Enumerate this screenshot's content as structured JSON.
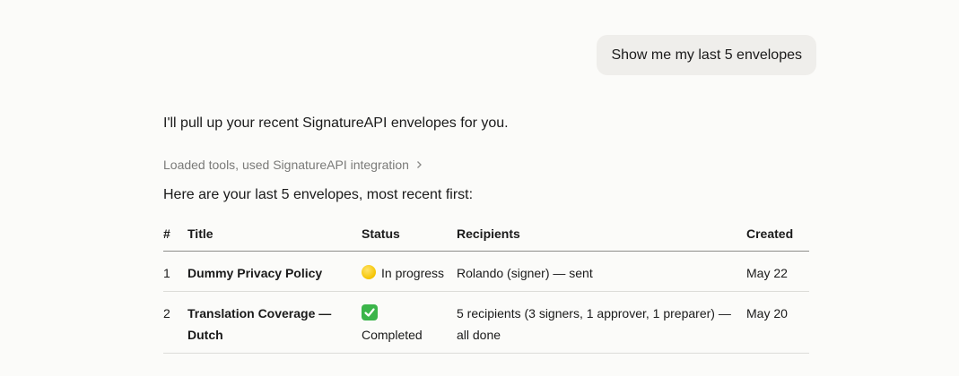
{
  "user_message": "Show me my last 5 envelopes",
  "assistant": {
    "intro": "I'll pull up your recent SignatureAPI envelopes for you.",
    "tools_line": "Loaded tools, used SignatureAPI integration",
    "summary": "Here are your last 5 envelopes, most recent first:"
  },
  "table": {
    "headers": {
      "num": "#",
      "title": "Title",
      "status": "Status",
      "recipients": "Recipients",
      "created": "Created"
    },
    "rows": [
      {
        "num": "1",
        "title": "Dummy Privacy Policy",
        "status_icon": "yellow-circle-icon",
        "status": "In progress",
        "recipients": "Rolando (signer) — sent",
        "created": "May 22"
      },
      {
        "num": "2",
        "title": "Translation Coverage — Dutch",
        "status_icon": "green-check-icon",
        "status": "Completed",
        "recipients": "5 recipients (3 signers, 1 approver, 1 preparer) — all done",
        "created": "May 20"
      }
    ]
  }
}
